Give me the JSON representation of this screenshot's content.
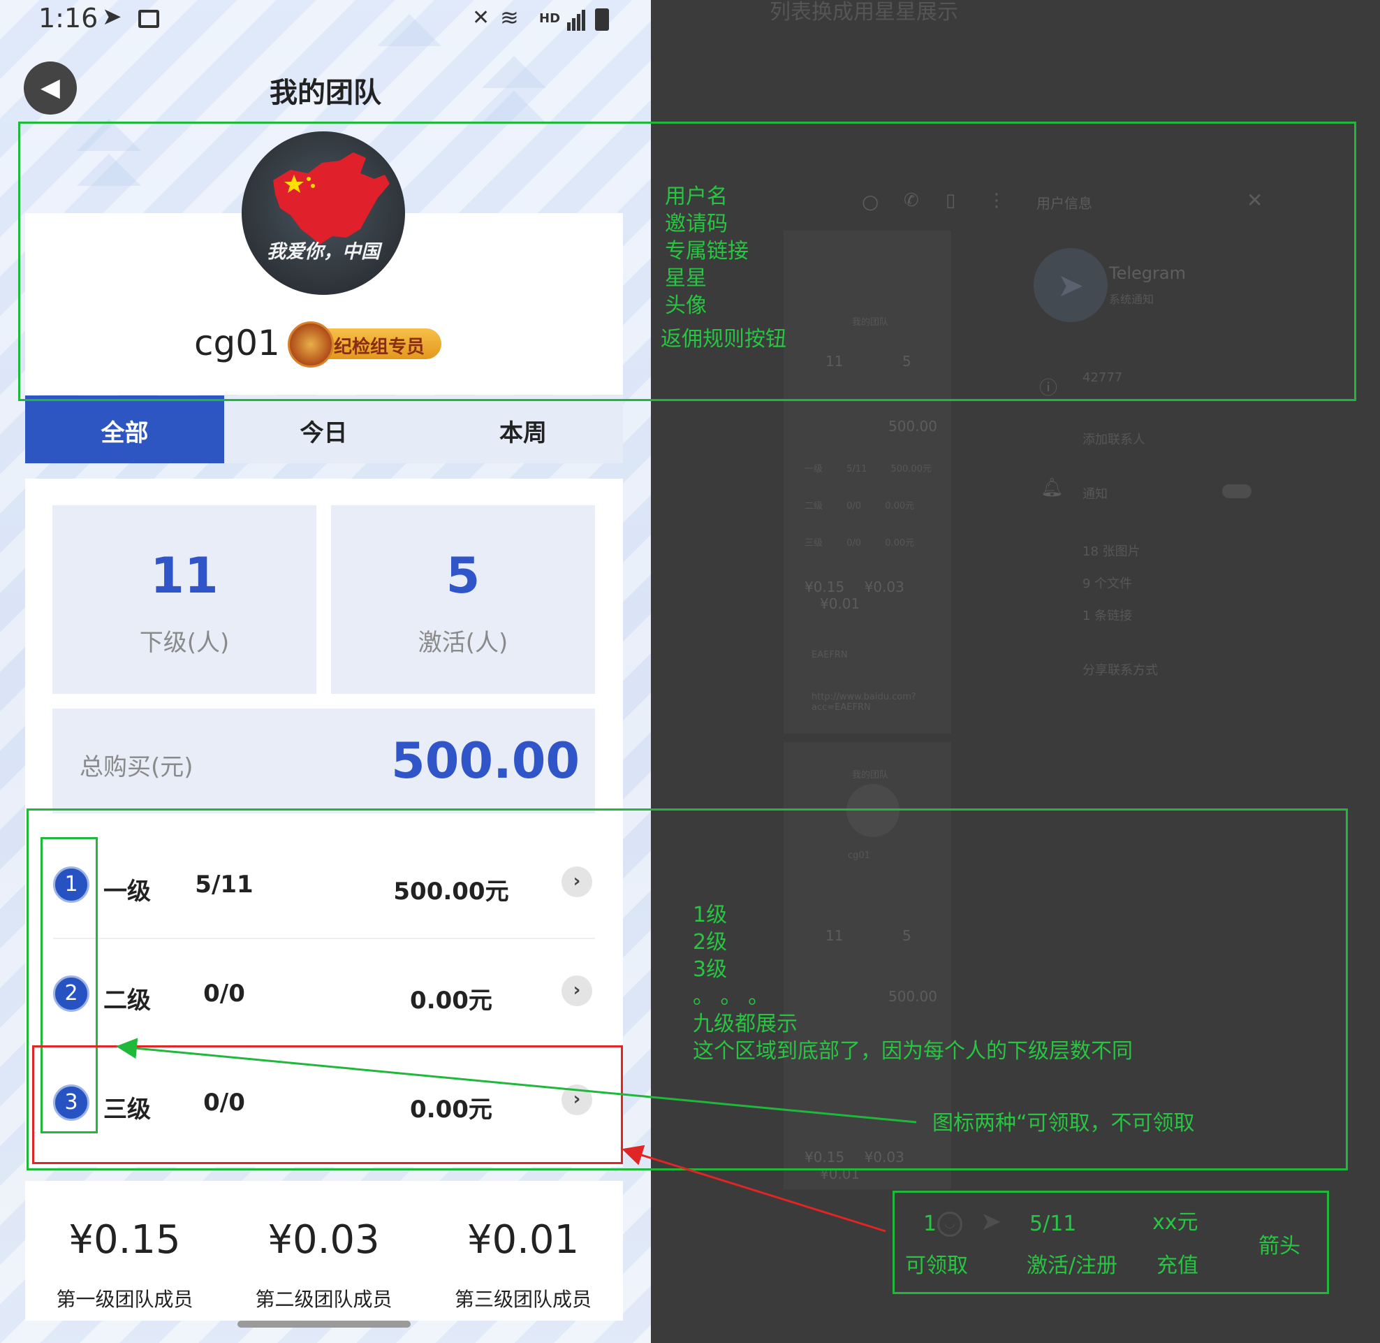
{
  "status_bar": {
    "time": "1:16",
    "network": "HD"
  },
  "header": {
    "title": "我的团队"
  },
  "profile": {
    "username": "cg01",
    "avatar_text": "我爱你，中国",
    "badge_label": "纪检组专员"
  },
  "tabs": [
    {
      "label": "全部",
      "active": true
    },
    {
      "label": "今日",
      "active": false
    },
    {
      "label": "本周",
      "active": false
    }
  ],
  "stats": {
    "subordinates": {
      "value": "11",
      "label": "下级(人)"
    },
    "activated": {
      "value": "5",
      "label": "激活(人)"
    },
    "total_purchase": {
      "label": "总购买(元)",
      "value": "500.00"
    }
  },
  "levels": [
    {
      "num": "1",
      "name": "一级",
      "ratio": "5/11",
      "amount": "500.00元"
    },
    {
      "num": "2",
      "name": "二级",
      "ratio": "0/0",
      "amount": "0.00元"
    },
    {
      "num": "3",
      "name": "三级",
      "ratio": "0/0",
      "amount": "0.00元"
    }
  ],
  "rebates": [
    {
      "amount": "¥0.15",
      "label": "第一级团队成员"
    },
    {
      "amount": "¥0.03",
      "label": "第二级团队成员"
    },
    {
      "amount": "¥0.01",
      "label": "第三级团队成员"
    }
  ],
  "background_window": {
    "top_text": "列表换成用星星展示",
    "user_info_title": "用户信息",
    "contact_name": "Telegram",
    "contact_sub": "系统通知",
    "phone_id": "42777",
    "add_contact": "添加联系人",
    "notify": "通知",
    "media": [
      "18 张图片",
      "9 个文件",
      "1 条链接"
    ],
    "share": "分享联系方式",
    "thumb": {
      "title": "我的团队",
      "stat_a": "11",
      "stat_b": "5",
      "total": "500.00",
      "rows": [
        {
          "name": "一级",
          "ratio": "5/11",
          "amount": "500.00元"
        },
        {
          "name": "二级",
          "ratio": "0/0",
          "amount": "0.00元"
        },
        {
          "name": "三级",
          "ratio": "0/0",
          "amount": "0.00元"
        }
      ],
      "rebates": [
        "¥0.15",
        "¥0.03",
        "¥0.01"
      ],
      "link_a": "EAEFRN",
      "link_b": "http://www.baidu.com?acc=EAEFRN",
      "user": "cg01"
    }
  },
  "annotations": {
    "profile_notes": [
      "用户名",
      "邀请码",
      "专属链接",
      "星星",
      "头像",
      "返佣规则按钮"
    ],
    "level_notes": [
      "1级",
      "2级",
      "3级",
      "。 。 。",
      "九级都展示",
      "这个区域到底部了，因为每个人的下级层数不同"
    ],
    "icon_note": "图标两种“可领取，不可领取",
    "legend": {
      "col1_top": "1",
      "col1_bottom": "可领取",
      "col2_top": "5/11",
      "col2_bottom": "激活/注册",
      "col3_top": "xx元",
      "col3_bottom": "充值",
      "col4": "箭头"
    }
  }
}
